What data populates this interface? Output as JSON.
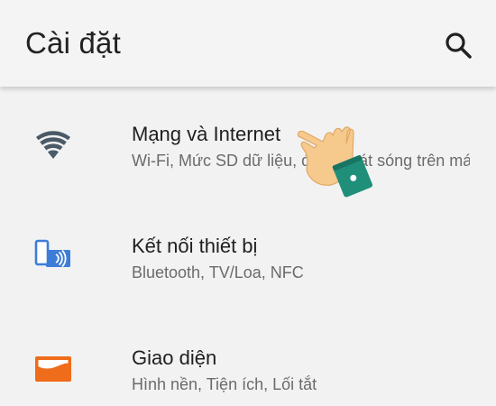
{
  "appbar": {
    "title": "Cài đặt",
    "search_icon": "search-icon"
  },
  "settings": {
    "items": [
      {
        "title": "Mạng và Internet",
        "subtitle": "Wi-Fi, Mức SD dữ liệu, điểm phát sóng trên máy ...",
        "icon": "wifi-icon",
        "icon_color": "#4a5a66"
      },
      {
        "title": "Kết nối thiết bị",
        "subtitle": "Bluetooth, TV/Loa, NFC",
        "icon": "connected-devices-icon",
        "icon_color": "#3d7dd8"
      },
      {
        "title": "Giao diện",
        "subtitle": "Hình nền, Tiện ích, Lối tắt",
        "icon": "display-icon",
        "icon_color": "#ef6c1a"
      }
    ]
  },
  "overlay": {
    "pointer_icon": "pointing-hand-icon"
  },
  "colors": {
    "background": "#f2f2f2",
    "title_text": "#202020",
    "subtitle_text": "#6b6b6b",
    "sleeve": "#1f8f7a",
    "skin": "#f6c98d"
  }
}
